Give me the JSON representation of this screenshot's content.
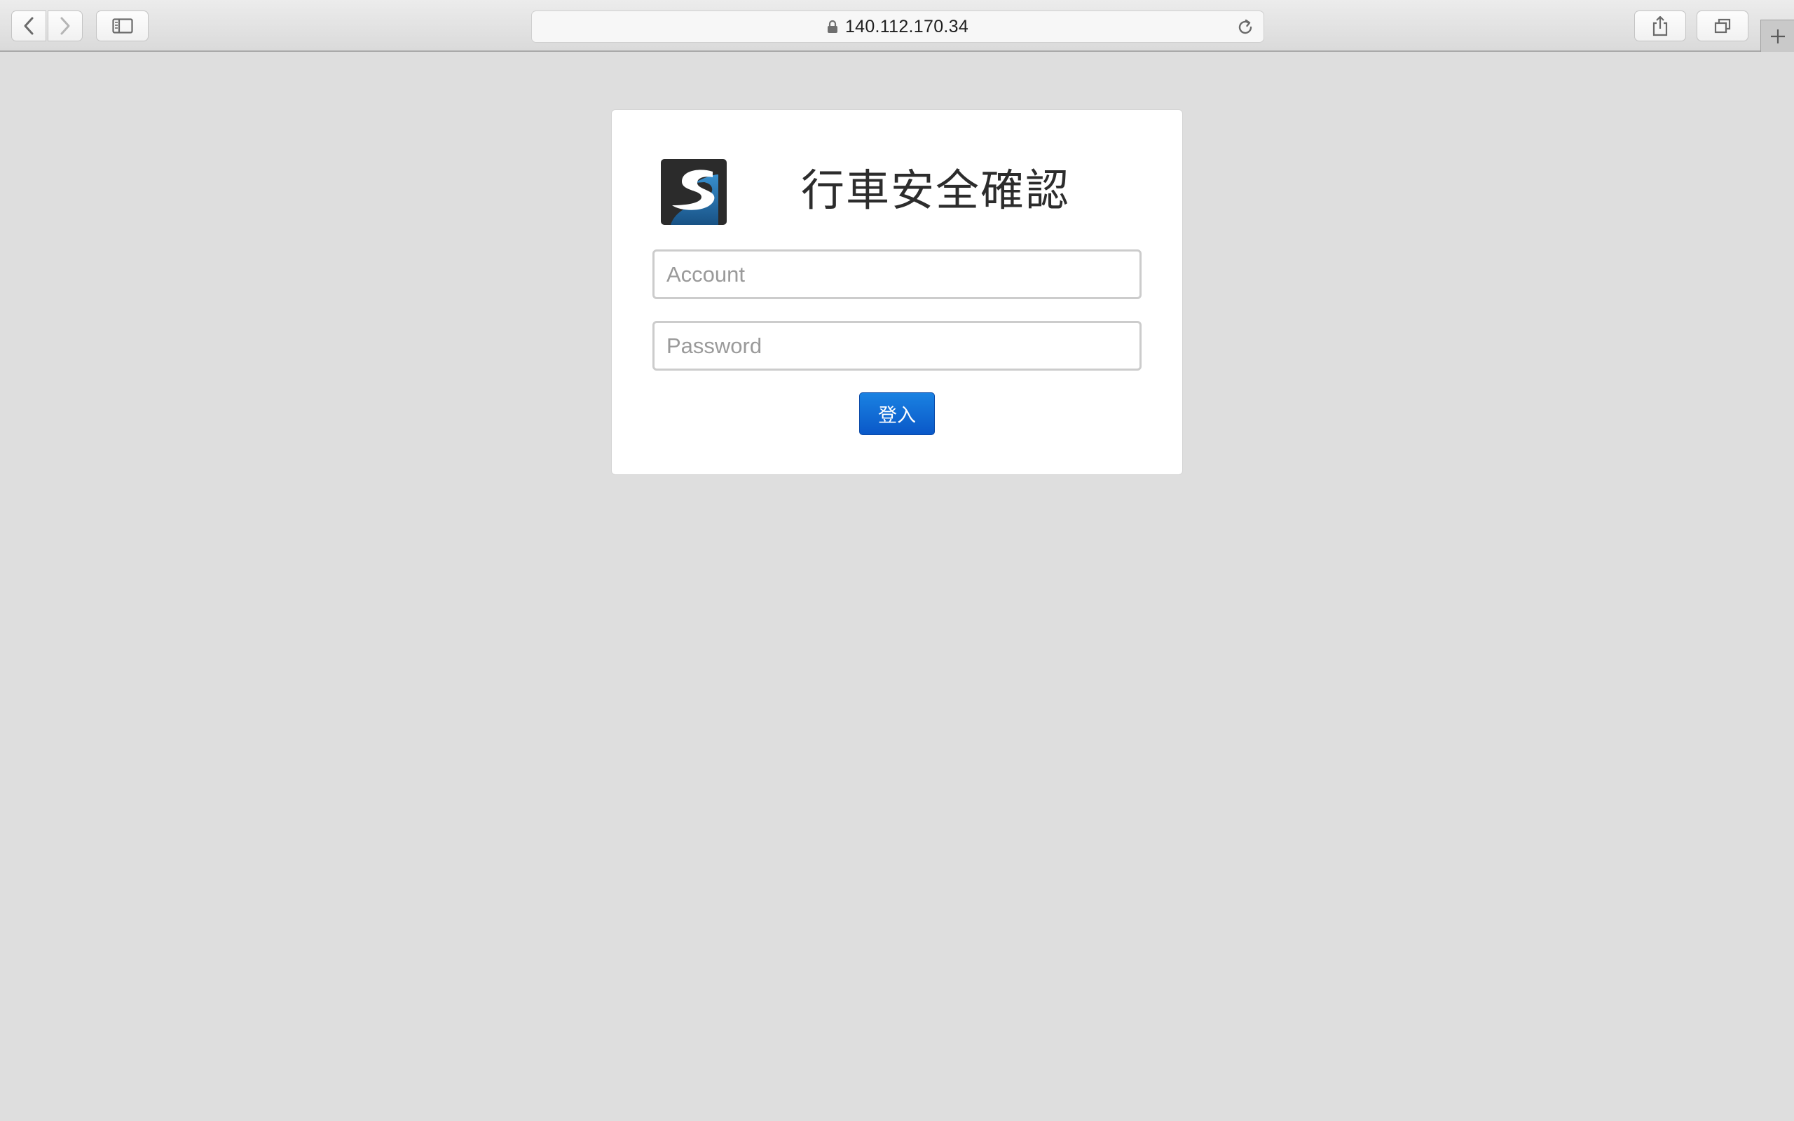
{
  "browser": {
    "url": "140.112.170.34",
    "icons": {
      "back": "chevron-left-icon",
      "forward": "chevron-right-icon",
      "sidebar": "sidebar-icon",
      "lock": "lock-icon",
      "reload": "reload-icon",
      "share": "share-icon",
      "tabs": "tabs-icon",
      "new_tab": "plus-icon"
    }
  },
  "login": {
    "title": "行車安全確認",
    "logo_letter": "S",
    "account_placeholder": "Account",
    "password_placeholder": "Password",
    "submit_label": "登入"
  },
  "colors": {
    "page_background": "#dedede",
    "button_blue": "#0d63d0",
    "logo_dark": "#2b2b2b",
    "logo_accent": "#1f7cc6"
  }
}
